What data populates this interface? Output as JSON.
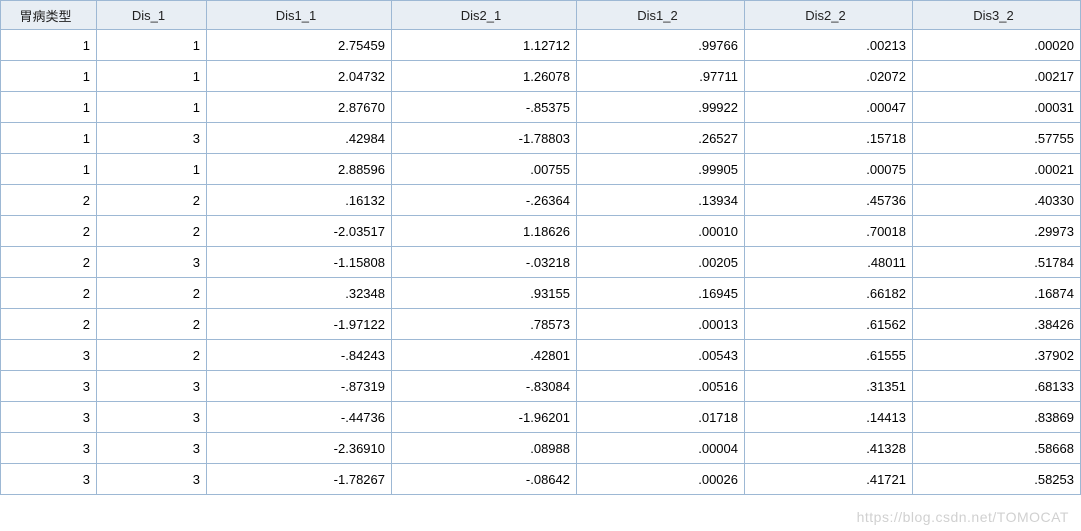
{
  "chart_data": {
    "type": "table",
    "columns": [
      "胃病类型",
      "Dis_1",
      "Dis1_1",
      "Dis2_1",
      "Dis1_2",
      "Dis2_2",
      "Dis3_2"
    ],
    "rows": [
      [
        "1",
        "1",
        "2.75459",
        "1.12712",
        ".99766",
        ".00213",
        ".00020"
      ],
      [
        "1",
        "1",
        "2.04732",
        "1.26078",
        ".97711",
        ".02072",
        ".00217"
      ],
      [
        "1",
        "1",
        "2.87670",
        "-.85375",
        ".99922",
        ".00047",
        ".00031"
      ],
      [
        "1",
        "3",
        ".42984",
        "-1.78803",
        ".26527",
        ".15718",
        ".57755"
      ],
      [
        "1",
        "1",
        "2.88596",
        ".00755",
        ".99905",
        ".00075",
        ".00021"
      ],
      [
        "2",
        "2",
        ".16132",
        "-.26364",
        ".13934",
        ".45736",
        ".40330"
      ],
      [
        "2",
        "2",
        "-2.03517",
        "1.18626",
        ".00010",
        ".70018",
        ".29973"
      ],
      [
        "2",
        "3",
        "-1.15808",
        "-.03218",
        ".00205",
        ".48011",
        ".51784"
      ],
      [
        "2",
        "2",
        ".32348",
        ".93155",
        ".16945",
        ".66182",
        ".16874"
      ],
      [
        "2",
        "2",
        "-1.97122",
        ".78573",
        ".00013",
        ".61562",
        ".38426"
      ],
      [
        "3",
        "2",
        "-.84243",
        ".42801",
        ".00543",
        ".61555",
        ".37902"
      ],
      [
        "3",
        "3",
        "-.87319",
        "-.83084",
        ".00516",
        ".31351",
        ".68133"
      ],
      [
        "3",
        "3",
        "-.44736",
        "-1.96201",
        ".01718",
        ".14413",
        ".83869"
      ],
      [
        "3",
        "3",
        "-2.36910",
        ".08988",
        ".00004",
        ".41328",
        ".58668"
      ],
      [
        "3",
        "3",
        "-1.78267",
        "-.08642",
        ".00026",
        ".41721",
        ".58253"
      ]
    ]
  },
  "watermark": "https://blog.csdn.net/TOMOCAT"
}
